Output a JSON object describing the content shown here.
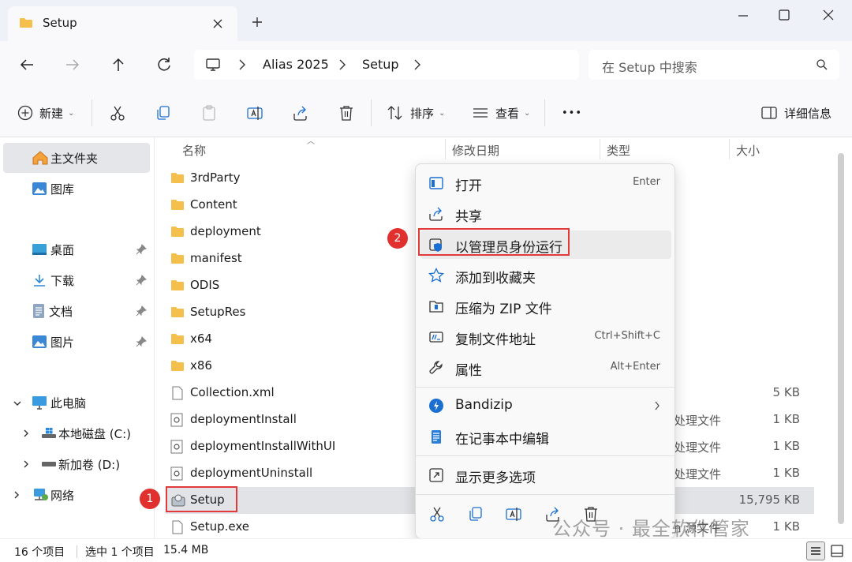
{
  "tab": {
    "title": "Setup",
    "new_tab": "+"
  },
  "window_controls": [
    "minimize",
    "maximize",
    "close"
  ],
  "address": {
    "crumbs": [
      "Alias 2025",
      "Setup"
    ],
    "search_placeholder": "在 Setup 中搜索"
  },
  "toolbar": {
    "new_label": "新建",
    "sort_label": "排序",
    "view_label": "查看",
    "more": "•••",
    "details_label": "详细信息"
  },
  "sidebar": {
    "home": "主文件夹",
    "gallery": "图库",
    "quick": [
      "桌面",
      "下载",
      "文档",
      "图片"
    ],
    "this_pc": "此电脑",
    "drives": [
      "本地磁盘 (C:)",
      "新加卷 (D:)"
    ],
    "network": "网络"
  },
  "columns": {
    "name": "名称",
    "modified": "修改日期",
    "type": "类型",
    "size": "大小"
  },
  "files": [
    {
      "name": "3rdParty",
      "kind": "folder",
      "type": "",
      "size": ""
    },
    {
      "name": "Content",
      "kind": "folder",
      "type": "",
      "size": ""
    },
    {
      "name": "deployment",
      "kind": "folder",
      "type": "",
      "size": ""
    },
    {
      "name": "manifest",
      "kind": "folder",
      "type": "",
      "size": ""
    },
    {
      "name": "ODIS",
      "kind": "folder",
      "type": "",
      "size": ""
    },
    {
      "name": "SetupRes",
      "kind": "folder",
      "type": "",
      "size": ""
    },
    {
      "name": "x64",
      "kind": "folder",
      "type": "",
      "size": ""
    },
    {
      "name": "x86",
      "kind": "folder",
      "type": "",
      "size": ""
    },
    {
      "name": "Collection.xml",
      "kind": "doc",
      "type": "",
      "size": "5 KB"
    },
    {
      "name": "deploymentInstall",
      "kind": "bat",
      "type": "处理文件",
      "size": "1 KB"
    },
    {
      "name": "deploymentInstallWithUI",
      "kind": "bat",
      "type": "处理文件",
      "size": "1 KB"
    },
    {
      "name": "deploymentUninstall",
      "kind": "bat",
      "type": "处理文件",
      "size": "1 KB"
    },
    {
      "name": "Setup",
      "kind": "setup",
      "type": "",
      "size": "15,795 KB"
    },
    {
      "name": "Setup.exe",
      "kind": "exe",
      "type": "n 源文件",
      "size": "1 KB"
    }
  ],
  "context_menu": {
    "items": [
      {
        "label": "打开",
        "key": "Enter"
      },
      {
        "label": "共享",
        "key": ""
      },
      {
        "label": "以管理员身份运行",
        "key": ""
      },
      {
        "label": "添加到收藏夹",
        "key": ""
      },
      {
        "label": "压缩为 ZIP 文件",
        "key": ""
      },
      {
        "label": "复制文件地址",
        "key": "Ctrl+Shift+C"
      },
      {
        "label": "属性",
        "key": "Alt+Enter"
      },
      {
        "label": "Bandizip",
        "key": ""
      },
      {
        "label": "在记事本中编辑",
        "key": ""
      },
      {
        "label": "显示更多选项",
        "key": ""
      }
    ]
  },
  "annotations": {
    "badge1": "1",
    "badge2": "2"
  },
  "status": {
    "count": "16 个项目",
    "selection": "选中 1 个项目",
    "size": "15.4 MB"
  },
  "watermark": "公众号 · 最全软件管家",
  "colors": {
    "folder": "#f4c04b",
    "accent": "#0067c0",
    "red": "#e23a3a"
  }
}
